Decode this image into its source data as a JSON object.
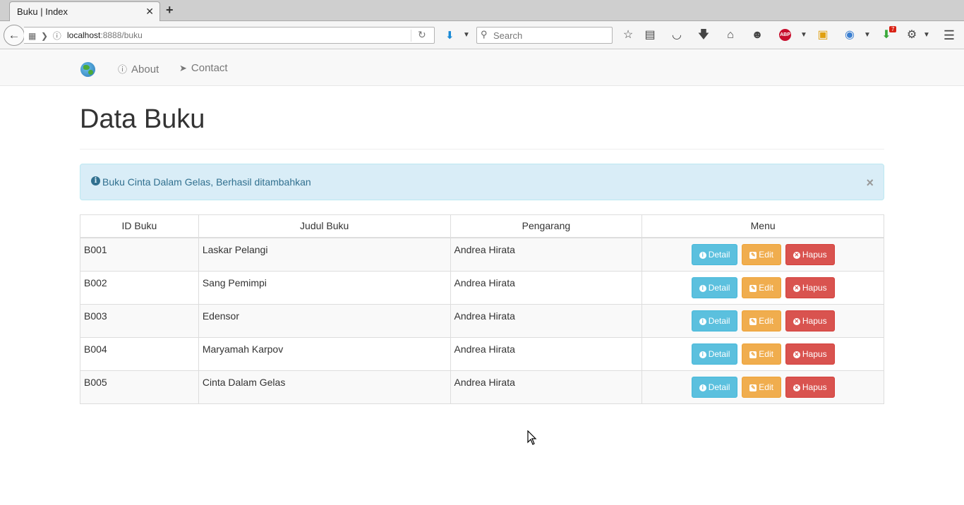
{
  "browser": {
    "tab_title": "Buku | Index",
    "tab_close": "✕",
    "new_tab": "+",
    "url_host": "localhost",
    "url_rest": ":8888/buku",
    "search_placeholder": "Search",
    "notification_badge": "7"
  },
  "site": {
    "nav": [
      {
        "label": "About",
        "icon": "info-icon"
      },
      {
        "label": "Contact",
        "icon": "paper-plane-icon"
      }
    ]
  },
  "page": {
    "title": "Data Buku",
    "alert": {
      "message": "Buku Cinta Dalam Gelas, Berhasil ditambahkan",
      "close": "×"
    }
  },
  "table": {
    "headers": [
      "ID Buku",
      "Judul Buku",
      "Pengarang",
      "Menu"
    ],
    "rows": [
      {
        "id": "B001",
        "judul": "Laskar Pelangi",
        "pengarang": "Andrea Hirata"
      },
      {
        "id": "B002",
        "judul": "Sang Pemimpi",
        "pengarang": "Andrea Hirata"
      },
      {
        "id": "B003",
        "judul": "Edensor",
        "pengarang": "Andrea Hirata"
      },
      {
        "id": "B004",
        "judul": "Maryamah Karpov",
        "pengarang": "Andrea Hirata"
      },
      {
        "id": "B005",
        "judul": "Cinta Dalam Gelas",
        "pengarang": "Andrea Hirata"
      }
    ],
    "actions": {
      "detail": "Detail",
      "edit": "Edit",
      "hapus": "Hapus"
    }
  },
  "colors": {
    "info": "#5bc0de",
    "warning": "#f0ad4e",
    "danger": "#d9534f",
    "alert_bg": "#d9edf7",
    "alert_text": "#31708f"
  }
}
